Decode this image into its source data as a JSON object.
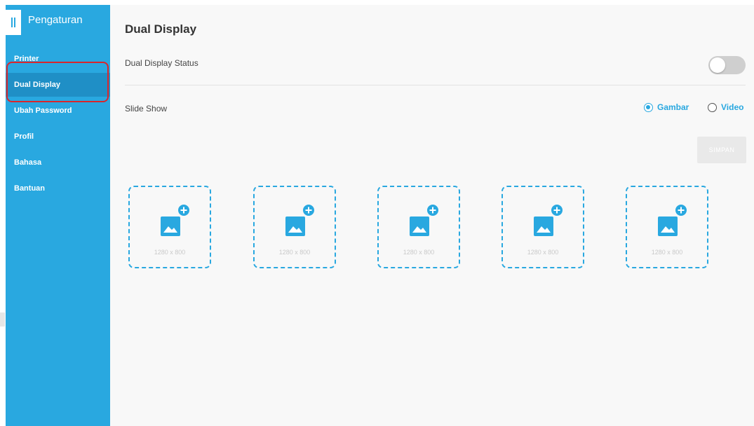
{
  "sidebar": {
    "title": "Pengaturan",
    "items": [
      {
        "label": "Printer"
      },
      {
        "label": "Dual Display"
      },
      {
        "label": "Ubah Password"
      },
      {
        "label": "Profil"
      },
      {
        "label": "Bahasa"
      },
      {
        "label": "Bantuan"
      }
    ],
    "active_item": "Dual Display"
  },
  "main": {
    "title": "Dual Display",
    "status_label": "Dual Display Status",
    "status_on": false,
    "slideshow_label": "Slide Show",
    "radios": [
      {
        "label": "Gambar",
        "checked": true
      },
      {
        "label": "Video",
        "checked": false
      }
    ],
    "save_label": "SIMPAN",
    "image_slots": [
      {
        "size": "1280 x 800"
      },
      {
        "size": "1280 x 800"
      },
      {
        "size": "1280 x 800"
      },
      {
        "size": "1280 x 800"
      },
      {
        "size": "1280 x 800"
      }
    ]
  },
  "colors": {
    "accent": "#29a8e0",
    "sidebar_active": "#1f8fc6",
    "highlight": "#d9262c"
  },
  "icons": [
    "menu-icon",
    "image-icon",
    "plus-circle-icon"
  ]
}
